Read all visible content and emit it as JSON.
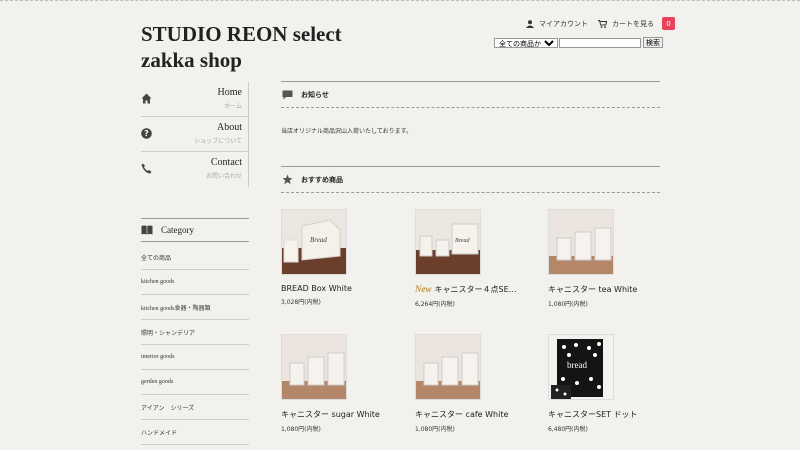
{
  "site": {
    "title_line1": "STUDIO REON select",
    "title_line2": "zakka shop"
  },
  "header": {
    "my_account": "マイアカウント",
    "view_cart": "カートを見る",
    "cart_count": "0"
  },
  "search": {
    "scope": "全ての商品から",
    "button": "検索"
  },
  "nav": [
    {
      "label": "Home",
      "sub": "ホーム",
      "icon": "home-icon"
    },
    {
      "label": "About",
      "sub": "ショップについて",
      "icon": "question-icon"
    },
    {
      "label": "Contact",
      "sub": "お問い合わせ",
      "icon": "phone-icon"
    }
  ],
  "category": {
    "title": "Category",
    "items": [
      "全ての商品",
      "kitchen goods",
      "kitchen goods食器・陶器類",
      "照明・シャンデリア",
      "interior goods",
      "gerden goods",
      "アイアン　シリーズ",
      "ハンドメイド"
    ]
  },
  "news": {
    "title": "お知らせ",
    "text": "当店オリジナル商品沢山入荷いたしております。"
  },
  "recommended": {
    "title": "おすすめ商品",
    "new_badge": "New",
    "products": [
      {
        "name": "BREAD Box White",
        "price": "3,028円(内税)"
      },
      {
        "name": "キャニスター４点SE…",
        "price": "6,264円(内税)"
      },
      {
        "name": "キャニスター tea White",
        "price": "1,080円(内税)"
      },
      {
        "name": "キャニスター sugar White",
        "price": "1,080円(内税)"
      },
      {
        "name": "キャニスター cafe White",
        "price": "1,080円(内税)"
      },
      {
        "name": "キャニスターSET ドット",
        "price": "6,480円(内税)"
      }
    ]
  }
}
